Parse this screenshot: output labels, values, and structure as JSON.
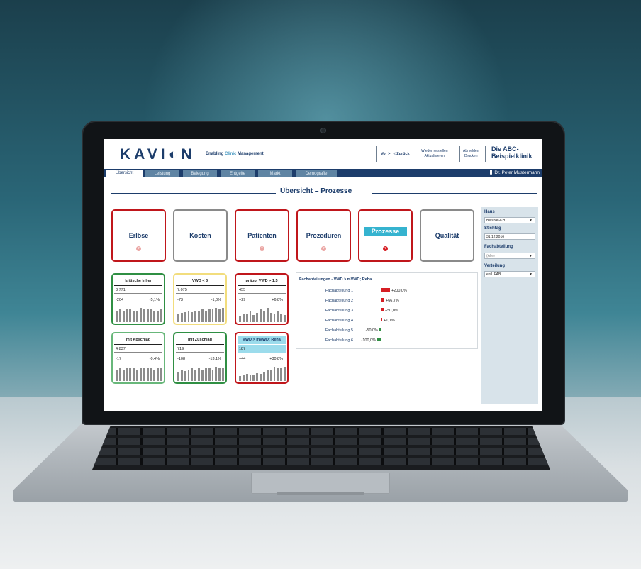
{
  "app": {
    "logo": "KAVI◐N",
    "tagline_a": "Enabling ",
    "tagline_b": "Clinic",
    "tagline_c": " Management",
    "nav": {
      "vor": "Vor >",
      "zurueck": "< Zurück",
      "wiederherstellen": "Wiederherstellen",
      "aktualisieren": "Aktualisieren",
      "abmelden": "Abmelden",
      "drucken": "Drucken"
    },
    "clinic_line1": "Die ABC-",
    "clinic_line2": "Beispielklinik"
  },
  "tabs": [
    "Übersicht",
    "Leistung",
    "Belegung",
    "Entgelte",
    "Markt",
    "Demografie"
  ],
  "user": "Dr. Peter Mustermann",
  "page_title": "Übersicht – Prozesse",
  "tiles": [
    {
      "label": "Erlöse"
    },
    {
      "label": "Kosten"
    },
    {
      "label": "Patienten"
    },
    {
      "label": "Prozeduren"
    },
    {
      "label": "Prozesse"
    },
    {
      "label": "Qualität"
    }
  ],
  "kpis": [
    {
      "title": "kritische Inlier",
      "value": "3.771",
      "delta": "-204",
      "pct": "-5,1%",
      "bars": [
        0.7,
        0.8,
        0.75,
        0.85,
        0.8,
        0.7,
        0.75,
        0.9,
        0.8,
        0.85,
        0.8,
        0.7,
        0.75,
        0.8
      ]
    },
    {
      "title": "VWD < 3",
      "value": "7.075",
      "delta": "-73",
      "pct": "-1,0%",
      "bars": [
        0.55,
        0.6,
        0.65,
        0.7,
        0.65,
        0.75,
        0.7,
        0.8,
        0.75,
        0.85,
        0.8,
        0.9,
        0.85,
        0.9
      ]
    },
    {
      "title": "präop. VWD > 1,5",
      "value": "455",
      "delta": "+29",
      "pct": "+6,8%",
      "bars": [
        0.4,
        0.5,
        0.55,
        0.7,
        0.45,
        0.6,
        0.8,
        0.75,
        0.9,
        0.6,
        0.55,
        0.7,
        0.5,
        0.45
      ]
    },
    {
      "title": "mit Abschlag",
      "value": "4.837",
      "delta": "-17",
      "pct": "-0,4%",
      "bars": [
        0.75,
        0.8,
        0.75,
        0.85,
        0.8,
        0.8,
        0.75,
        0.85,
        0.8,
        0.85,
        0.8,
        0.75,
        0.8,
        0.85
      ]
    },
    {
      "title": "mit Zuschlag",
      "value": "719",
      "delta": "-108",
      "pct": "-13,1%",
      "bars": [
        0.6,
        0.7,
        0.65,
        0.75,
        0.8,
        0.7,
        0.85,
        0.75,
        0.8,
        0.85,
        0.75,
        0.9,
        0.85,
        0.8
      ]
    },
    {
      "title": "VWD > mVWD; Reha",
      "value": "187",
      "delta": "+44",
      "pct": "+30,8%",
      "bars": [
        0.3,
        0.4,
        0.45,
        0.4,
        0.35,
        0.5,
        0.45,
        0.55,
        0.7,
        0.75,
        0.9,
        0.8,
        0.85,
        0.9
      ]
    }
  ],
  "chart_data": {
    "type": "bar",
    "title": "Fachabteilungen - VWD > mVWD; Reha",
    "categories": [
      "Fachabteilung 1",
      "Fachabteilung 2",
      "Fachabteilung 3",
      "Fachabteilung 4",
      "Fachabteilung 5",
      "Fachabteilung 6"
    ],
    "values": [
      200.0,
      66.7,
      50.0,
      1.1,
      -50.0,
      -100.0
    ],
    "labels": [
      "+200,0%",
      "+66,7%",
      "+50,0%",
      "+1,1%",
      "-50,0%",
      "-100,0%"
    ],
    "colors": {
      "positive": "#d61e24",
      "negative": "#2f8f43"
    }
  },
  "sidebar": {
    "haus_label": "Haus",
    "haus_value": "Beispiel-KH",
    "stichtag_label": "Stichtag",
    "stichtag_value": "31.12.2016",
    "fach_label": "Fachabteilung",
    "fach_value": "(Alle)",
    "vert_label": "Verteilung",
    "vert_value": "entl. FAB"
  },
  "colors": {
    "navy": "#1d3d6b",
    "alert_red": "#c0161b",
    "ok_green": "#2f8f43",
    "accent_cyan": "#35b3cf"
  }
}
